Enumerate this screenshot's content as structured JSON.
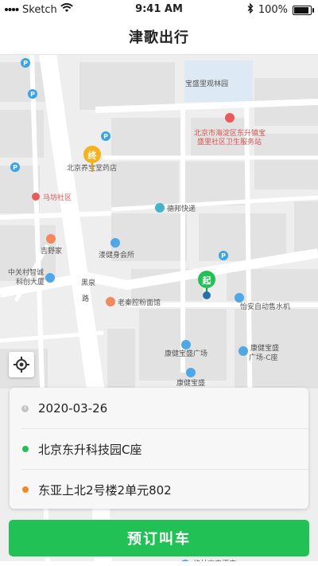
{
  "status_bar": {
    "carrier": "Sketch",
    "time": "9:41 AM",
    "battery": "100%",
    "battery_level": 1.0
  },
  "nav": {
    "title": "津歌出行"
  },
  "map": {
    "pois": [
      {
        "label": "宝盛里观林园"
      },
      {
        "label": "北京市海淀区东升镇宝"
      },
      {
        "label": "盛里社区卫生服务站"
      },
      {
        "label": "北京养宝堂药店"
      },
      {
        "label": "马坊社区"
      },
      {
        "label": "德邦快递"
      },
      {
        "label": "吉野家"
      },
      {
        "label": "溇健身会所"
      },
      {
        "label": "中关村智诚"
      },
      {
        "label": "科创大厦"
      },
      {
        "label": "黑泉"
      },
      {
        "label": "路"
      },
      {
        "label": "老秦腔粉面馆"
      },
      {
        "label": "怡安自动售水机"
      },
      {
        "label": "康健宝盛广场"
      },
      {
        "label": "康健宝盛"
      },
      {
        "label": "广场-C座"
      },
      {
        "label": "康健宝盛"
      },
      {
        "label": "格林豪泰酒店"
      }
    ],
    "end_marker": "终",
    "start_marker": "起"
  },
  "trip": {
    "date": "2020-03-26",
    "start": "北京东升科技园C座",
    "destination": "东亚上北2号楼2单元802",
    "start_dot_color": "#22c155",
    "dest_dot_color": "#f08a24"
  },
  "book_button": {
    "label": "预订叫车"
  }
}
